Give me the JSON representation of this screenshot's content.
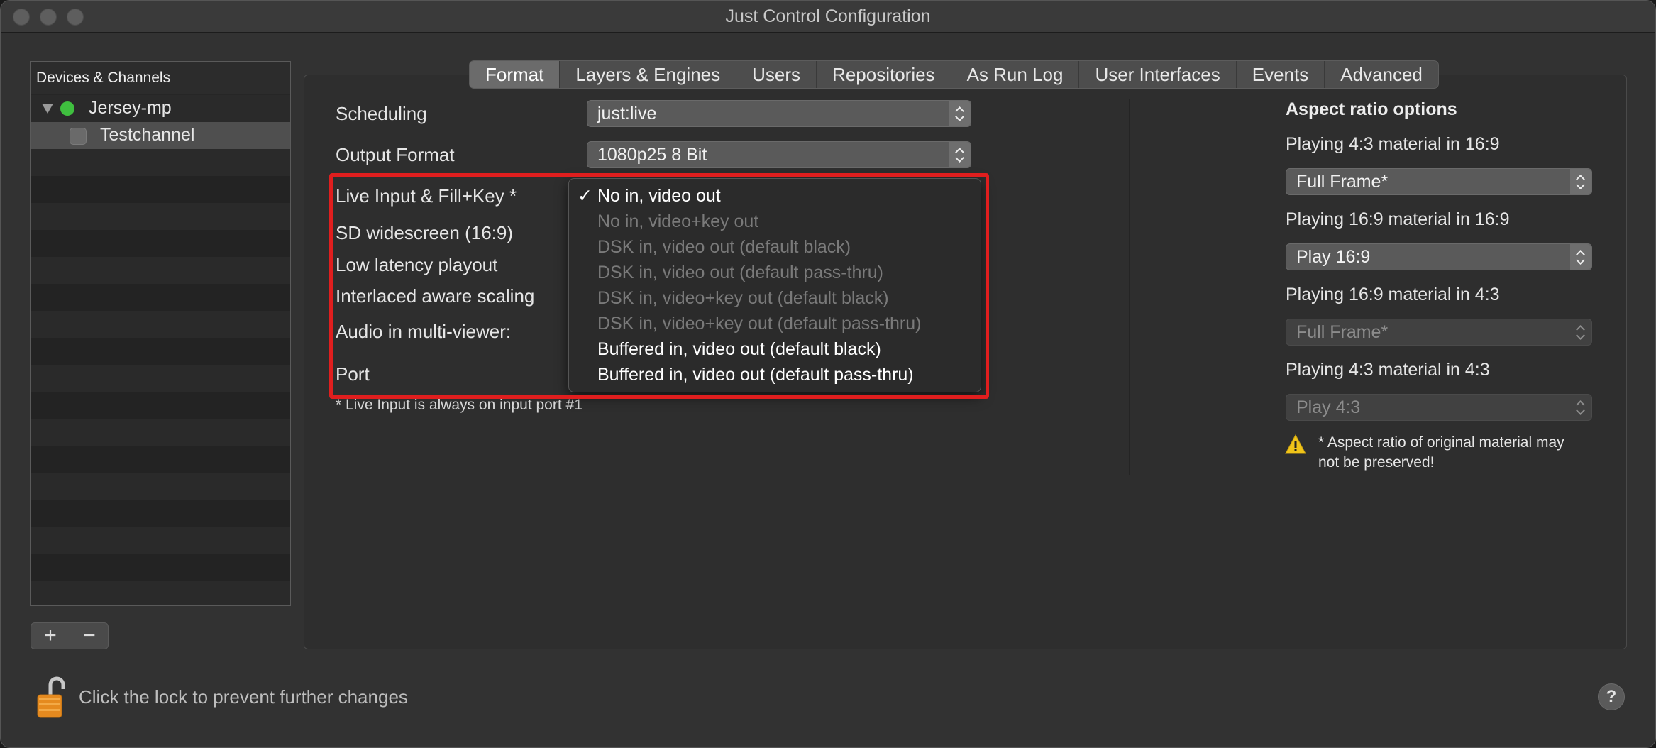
{
  "window": {
    "title": "Just Control Configuration"
  },
  "sidebar": {
    "header": "Devices & Channels",
    "items": [
      {
        "label": "Jersey-mp",
        "status_color": "#3fbf3f"
      },
      {
        "label": "Testchannel"
      }
    ],
    "add_label": "+",
    "remove_label": "−"
  },
  "tabs": [
    "Format",
    "Layers & Engines",
    "Users",
    "Repositories",
    "As Run Log",
    "User Interfaces",
    "Events",
    "Advanced"
  ],
  "active_tab": "Format",
  "format": {
    "scheduling_label": "Scheduling",
    "scheduling_value": "just:live",
    "output_format_label": "Output Format",
    "output_format_value": "1080p25 8 Bit",
    "live_input_label": "Live Input & Fill+Key *",
    "sd_widescreen_label": "SD widescreen (16:9)",
    "low_latency_label": "Low latency playout",
    "interlaced_label": "Interlaced aware scaling",
    "audio_label": "Audio in multi-viewer:",
    "port_label": "Port",
    "footnote": "* Live Input is always on input port #1"
  },
  "dropdown": {
    "checkmark": "✓",
    "items": [
      {
        "label": "No in, video out",
        "enabled": true,
        "checked": true
      },
      {
        "label": "No in, video+key out",
        "enabled": false
      },
      {
        "label": "DSK in, video out (default black)",
        "enabled": false
      },
      {
        "label": "DSK in, video out (default pass-thru)",
        "enabled": false
      },
      {
        "label": "DSK in, video+key out (default black)",
        "enabled": false
      },
      {
        "label": "DSK in, video+key out (default pass-thru)",
        "enabled": false
      },
      {
        "label": "Buffered in, video out (default black)",
        "enabled": true
      },
      {
        "label": "Buffered in, video out (default pass-thru)",
        "enabled": true
      }
    ],
    "highlight_color": "#e01e1e"
  },
  "aspect": {
    "title": "Aspect ratio options",
    "rows": [
      {
        "label": "Playing 4:3 material in 16:9",
        "value": "Full Frame*",
        "enabled": true
      },
      {
        "label": "Playing 16:9 material in 16:9",
        "value": "Play 16:9",
        "enabled": true
      },
      {
        "label": "Playing 16:9 material in 4:3",
        "value": "Full Frame*",
        "enabled": false
      },
      {
        "label": "Playing 4:3 material in 4:3",
        "value": "Play 4:3",
        "enabled": false
      }
    ],
    "warning": "* Aspect ratio of original material may not be preserved!"
  },
  "footer": {
    "lock_text": "Click the lock to prevent further changes",
    "help_label": "?"
  }
}
